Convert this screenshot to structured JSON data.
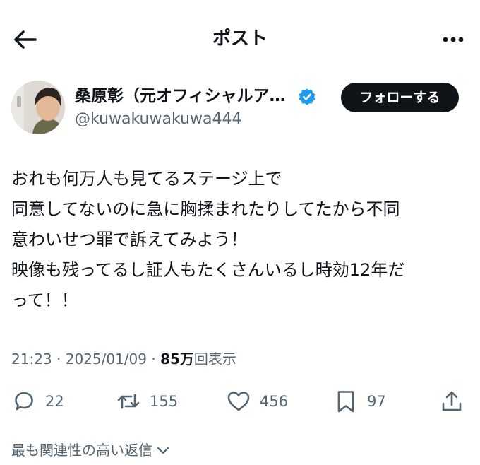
{
  "header": {
    "title": "ポスト"
  },
  "user": {
    "display_name": "桑原彰（元オフィシャルア…",
    "handle": "@kuwakuwakuwa444",
    "follow_label": "フォローする"
  },
  "tweet": {
    "lines": [
      "おれも何万人も見てるステージ上で",
      "同意してないのに急に胸揉まれたりしてたから不同",
      "意わいせつ罪で訴えてみよう！",
      "映像も残ってるし証人もたくさんいるし時効12年だ",
      "って！！"
    ],
    "time": "21:23",
    "sep1": " · ",
    "date": "2025/01/09",
    "sep2": " · ",
    "views": "85万",
    "views_label": "回表示"
  },
  "actions": {
    "replies": "22",
    "reposts": "155",
    "likes": "456",
    "bookmarks": "97"
  },
  "replies_sort": {
    "label": "最も関連性の高い返信"
  },
  "colors": {
    "accent": "#1d9bf0",
    "text": "#0f1419",
    "muted": "#536471"
  },
  "icons": {
    "back": "arrow-left-icon",
    "more": "more-horizontal-icon",
    "verified": "verified-badge-icon",
    "reply": "reply-icon",
    "repost": "repost-icon",
    "like": "heart-icon",
    "bookmark": "bookmark-icon",
    "share": "share-icon",
    "chevron": "chevron-down-icon"
  }
}
